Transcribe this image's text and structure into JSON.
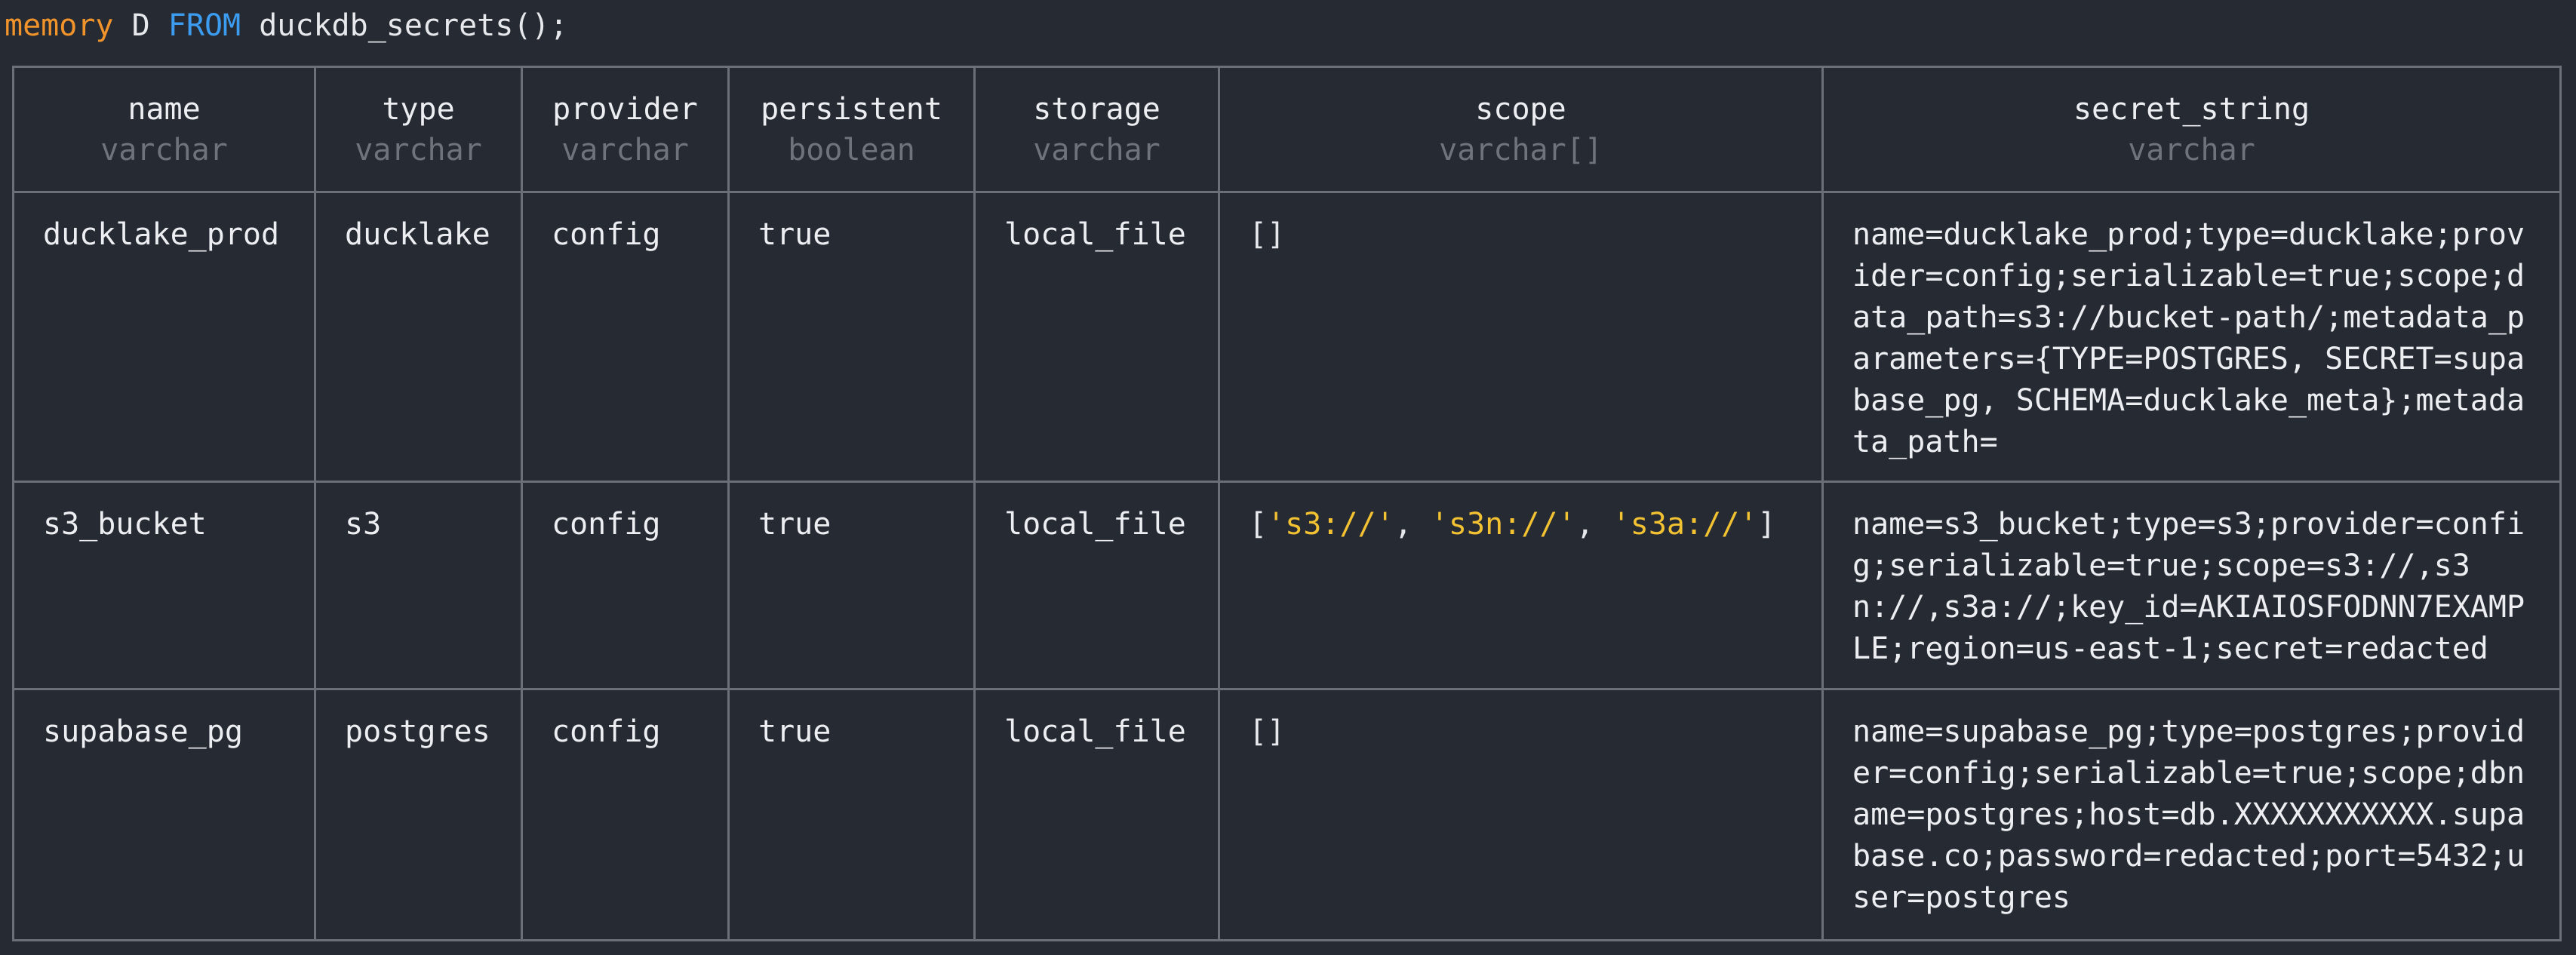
{
  "prompt": {
    "database": "memory",
    "indicator": "D",
    "keyword": "FROM",
    "query_rest": "duckdb_secrets();"
  },
  "columns": [
    {
      "name": "name",
      "type": "varchar"
    },
    {
      "name": "type",
      "type": "varchar"
    },
    {
      "name": "provider",
      "type": "varchar"
    },
    {
      "name": "persistent",
      "type": "boolean"
    },
    {
      "name": "storage",
      "type": "varchar"
    },
    {
      "name": "scope",
      "type": "varchar[]"
    },
    {
      "name": "secret_string",
      "type": "varchar"
    }
  ],
  "rows": [
    {
      "name": "ducklake_prod",
      "type": "ducklake",
      "provider": "config",
      "persistent": "true",
      "storage": "local_file",
      "scope": [],
      "secret_string": "name=ducklake_prod;type=ducklake;provider=config;serializable=true;scope;data_path=s3://bucket-path/;metadata_parameters={TYPE=POSTGRES, SECRET=supabase_pg, SCHEMA=ducklake_meta};metadata_path="
    },
    {
      "name": "s3_bucket",
      "type": "s3",
      "provider": "config",
      "persistent": "true",
      "storage": "local_file",
      "scope": [
        "'s3://'",
        "'s3n://'",
        "'s3a://'"
      ],
      "secret_string": "name=s3_bucket;type=s3;provider=config;serializable=true;scope=s3://,s3n://,s3a://;key_id=AKIAIOSFODNN7EXAMPLE;region=us-east-1;secret=redacted"
    },
    {
      "name": "supabase_pg",
      "type": "postgres",
      "provider": "config",
      "persistent": "true",
      "storage": "local_file",
      "scope": [],
      "secret_string": "name=supabase_pg;type=postgres;provider=config;serializable=true;scope;dbname=postgres;host=db.XXXXXXXXXXX.supabase.co;password=redacted;port=5432;user=postgres"
    }
  ],
  "colors": {
    "background": "#262a33",
    "text": "#eceef2",
    "muted_type": "#6f737c",
    "grid": "#6b6f78",
    "keyword_db": "#f0932b",
    "keyword_sql": "#3b9cf0",
    "string_literal": "#f2c232"
  }
}
